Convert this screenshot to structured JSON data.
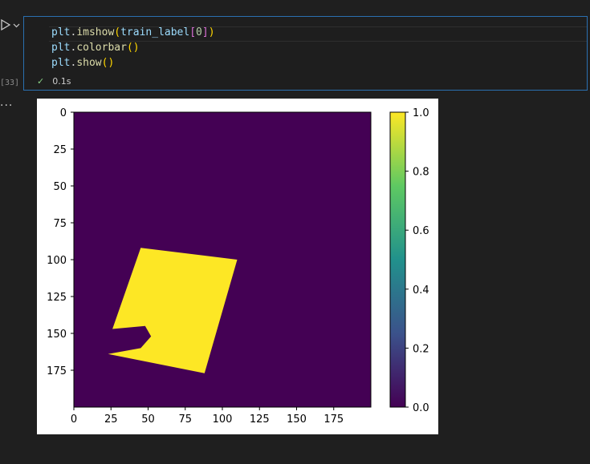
{
  "cell": {
    "execution_count": "[33]",
    "code_lines": [
      {
        "var": "plt",
        "dot": ".",
        "fn": "imshow",
        "open": "(",
        "arg": "train_label",
        "bopen": "[",
        "num": "0",
        "bclose": "]",
        "close": ")"
      },
      {
        "var": "plt",
        "dot": ".",
        "fn": "colorbar",
        "open": "(",
        "close": ")"
      },
      {
        "var": "plt",
        "dot": ".",
        "fn": "show",
        "open": "(",
        "close": ")"
      }
    ],
    "status_time": "0.1s",
    "more_label": "..."
  },
  "icons": {
    "run": "run-icon",
    "run_dropdown": "chevron-down-icon",
    "success": "check-icon"
  },
  "chart_data": {
    "type": "heatmap",
    "title": "",
    "xlabel": "",
    "ylabel": "",
    "xlim": [
      0,
      200
    ],
    "ylim": [
      200,
      0
    ],
    "xticks": [
      0,
      25,
      50,
      75,
      100,
      125,
      150,
      175
    ],
    "yticks": [
      0,
      25,
      50,
      75,
      100,
      125,
      150,
      175
    ],
    "colormap": "viridis",
    "background_color": "#440154",
    "foreground_color": "#fde725",
    "value_range": [
      0,
      1
    ],
    "mask_shape_vertices": [
      [
        45,
        92
      ],
      [
        110,
        100
      ],
      [
        88,
        177
      ],
      [
        23,
        164
      ],
      [
        45,
        160
      ],
      [
        52,
        152
      ],
      [
        48,
        145
      ],
      [
        26,
        147
      ]
    ],
    "colorbar": {
      "ticks": [
        0.0,
        0.2,
        0.4,
        0.6,
        0.8,
        1.0
      ],
      "tick_labels": [
        "0.0",
        "0.2",
        "0.4",
        "0.6",
        "0.8",
        "1.0"
      ]
    },
    "grid": false
  }
}
